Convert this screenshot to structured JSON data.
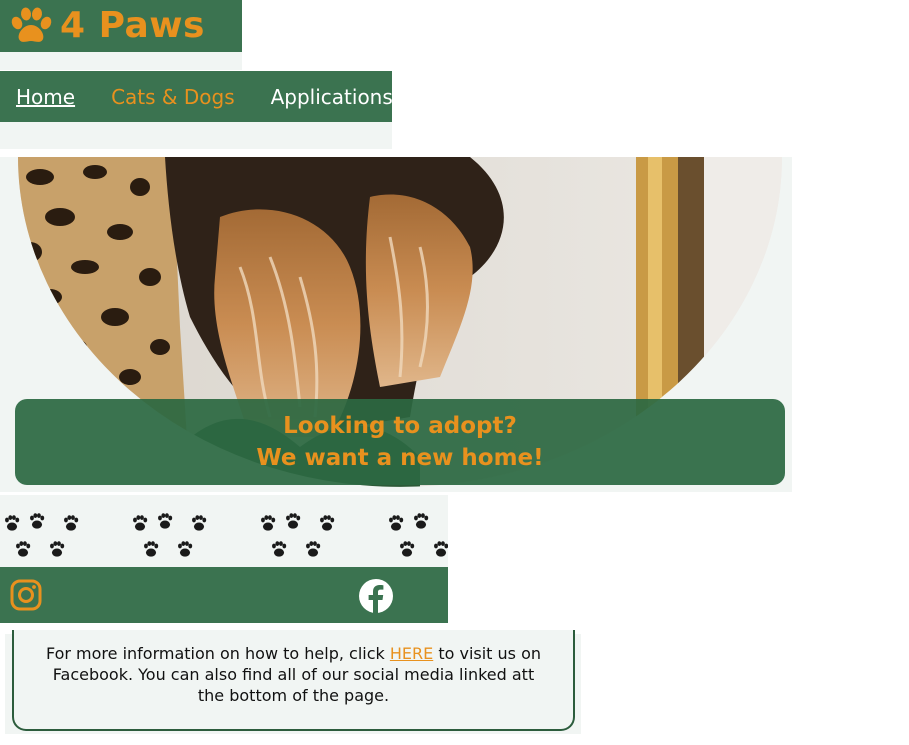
{
  "brand": {
    "logo_icon": "paw-icon",
    "name": "4 Paws"
  },
  "nav": {
    "items": [
      {
        "label": "Home",
        "active": true
      },
      {
        "label": "Cats & Dogs"
      },
      {
        "label": "Applications"
      }
    ]
  },
  "hero": {
    "image": "cat-and-dog-photo",
    "line1": "Looking to adopt?",
    "line2": "We want a new home!"
  },
  "social": {
    "instagram_icon": "instagram-icon",
    "facebook_icon": "facebook-icon"
  },
  "info": {
    "text_before": "For more information on how to help, click ",
    "link_text": "HERE",
    "text_after": " to visit us on Facebook. You can also find all of our social media linked att the bottom of the page."
  },
  "colors": {
    "brand_green": "#3b7350",
    "accent_orange": "#e8911e",
    "light_bg": "#f1f5f3"
  }
}
